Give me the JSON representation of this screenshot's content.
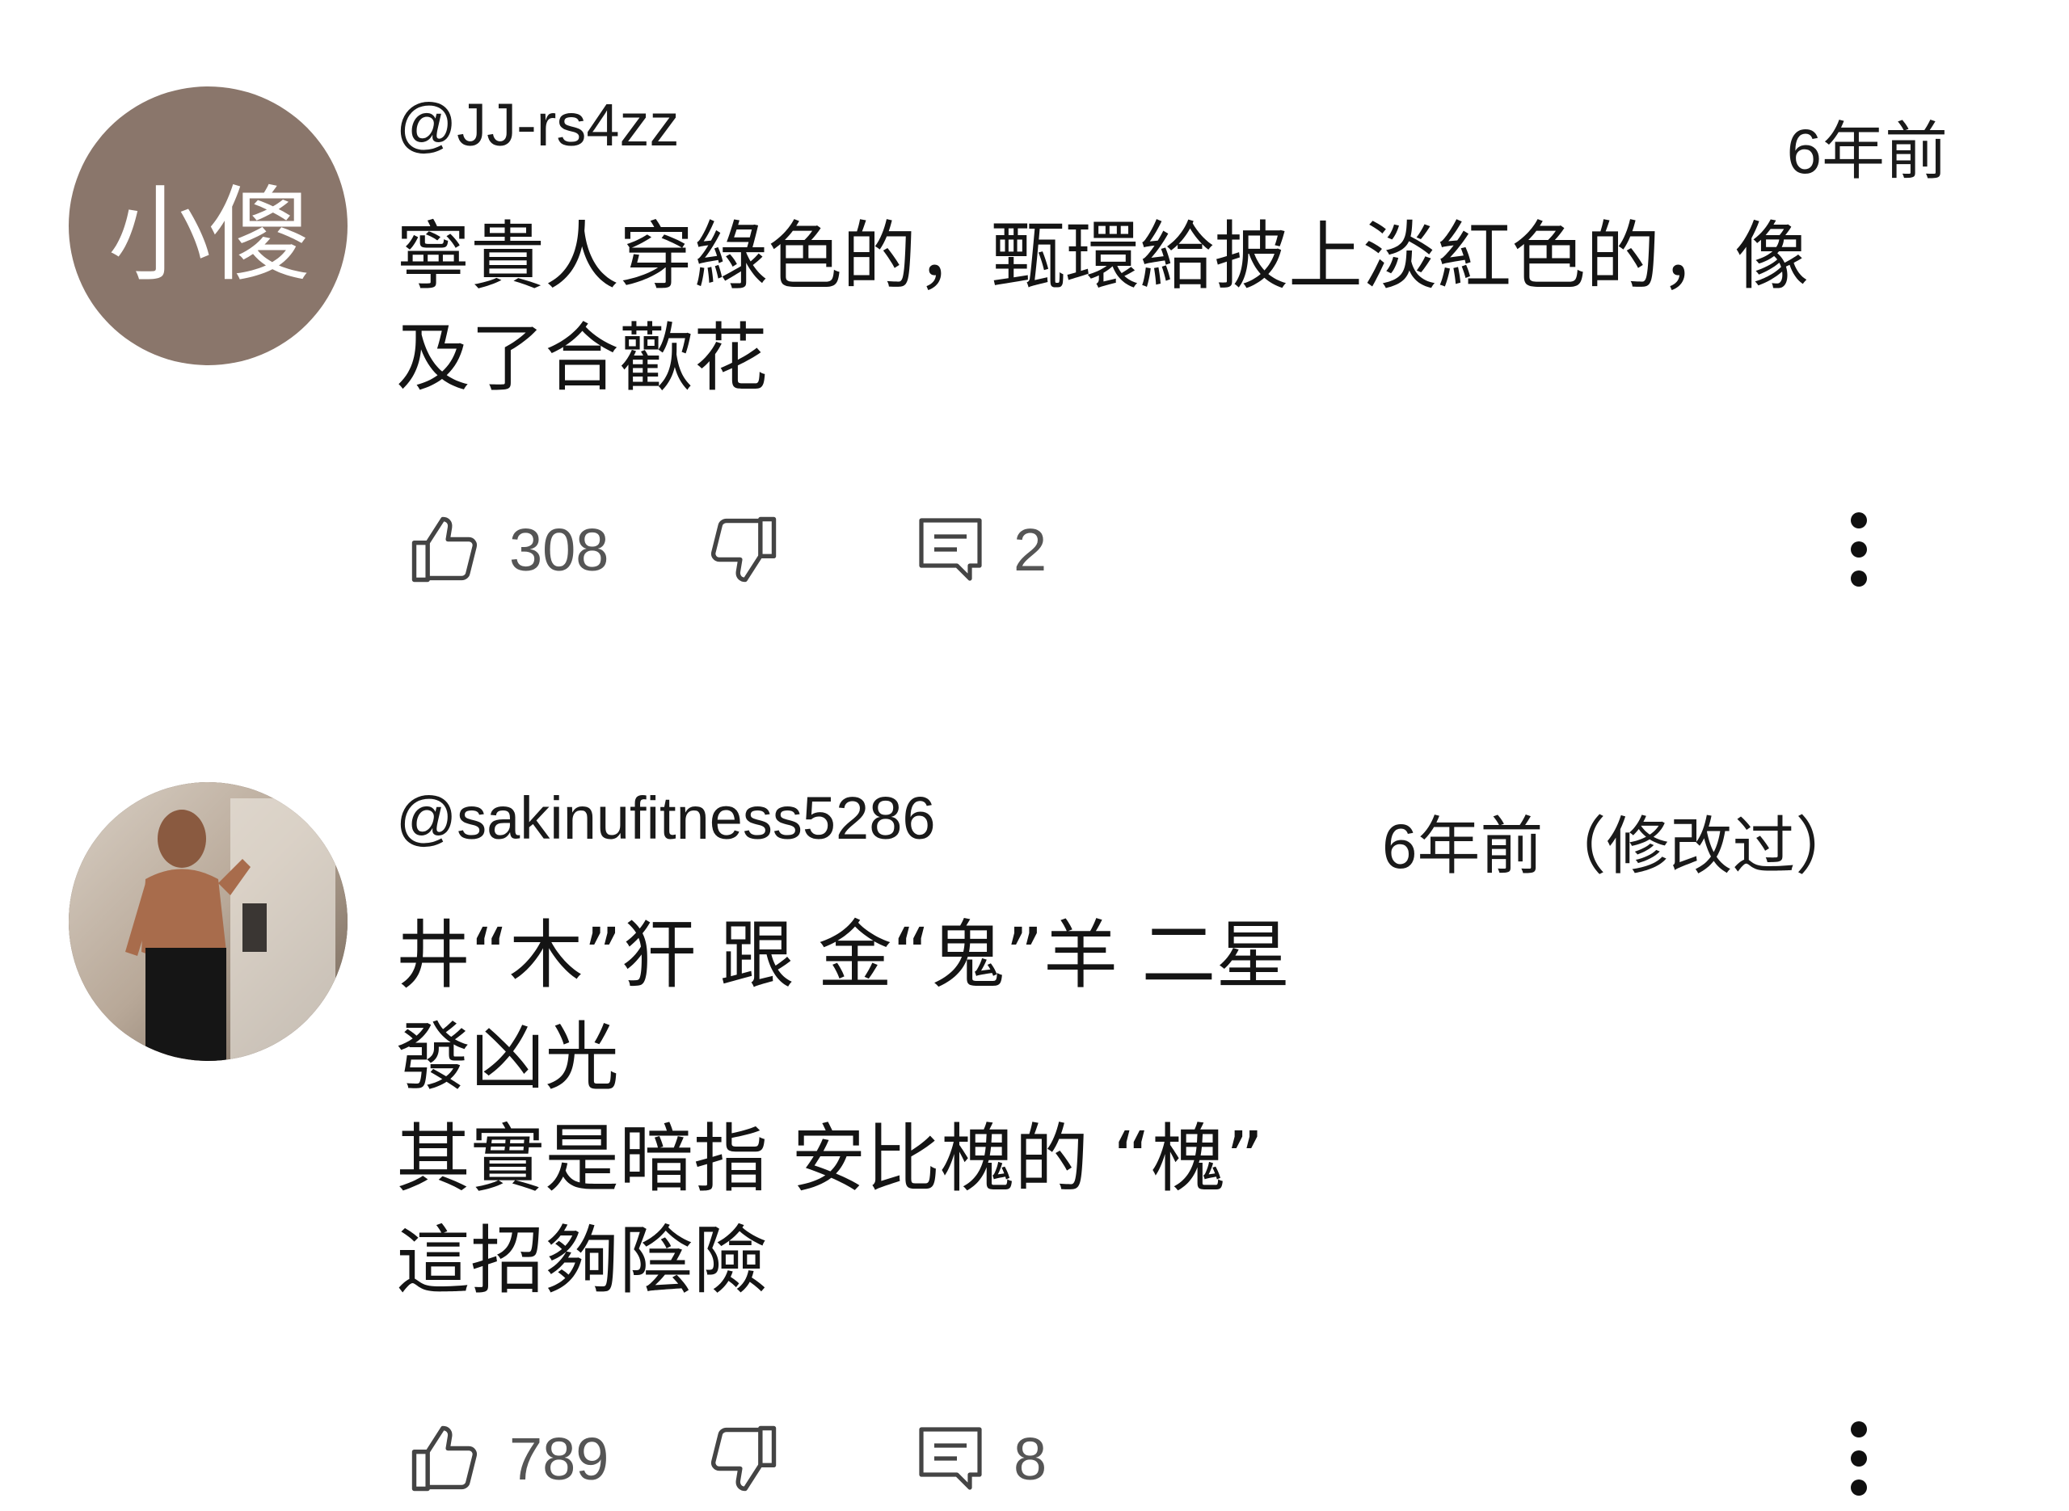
{
  "comments": [
    {
      "avatar_text": "小傻",
      "avatar_color": "#8a766b",
      "username": "@JJ-rs4zz",
      "timestamp": "6年前",
      "lines": [
        "寧貴人穿綠色的，甄環給披上淡紅色的，像",
        "及了合歡花"
      ],
      "likes": "308",
      "replies": "2"
    },
    {
      "avatar_type": "photo",
      "username": "@sakinufitness5286",
      "timestamp": "6年前（修改过）",
      "lines": [
        "井“木”犴  跟 金“鬼”羊 二星",
        "發凶光",
        "其實是暗指 安比槐的 “槐”",
        "這招夠陰險"
      ],
      "likes": "789",
      "replies": "8"
    }
  ],
  "icons": {
    "like": "thumbs-up-icon",
    "dislike": "thumbs-down-icon",
    "reply": "reply-icon",
    "more": "more-vertical-icon"
  },
  "colors": {
    "text": "#111111",
    "count": "#555555",
    "icon": "#444444"
  }
}
